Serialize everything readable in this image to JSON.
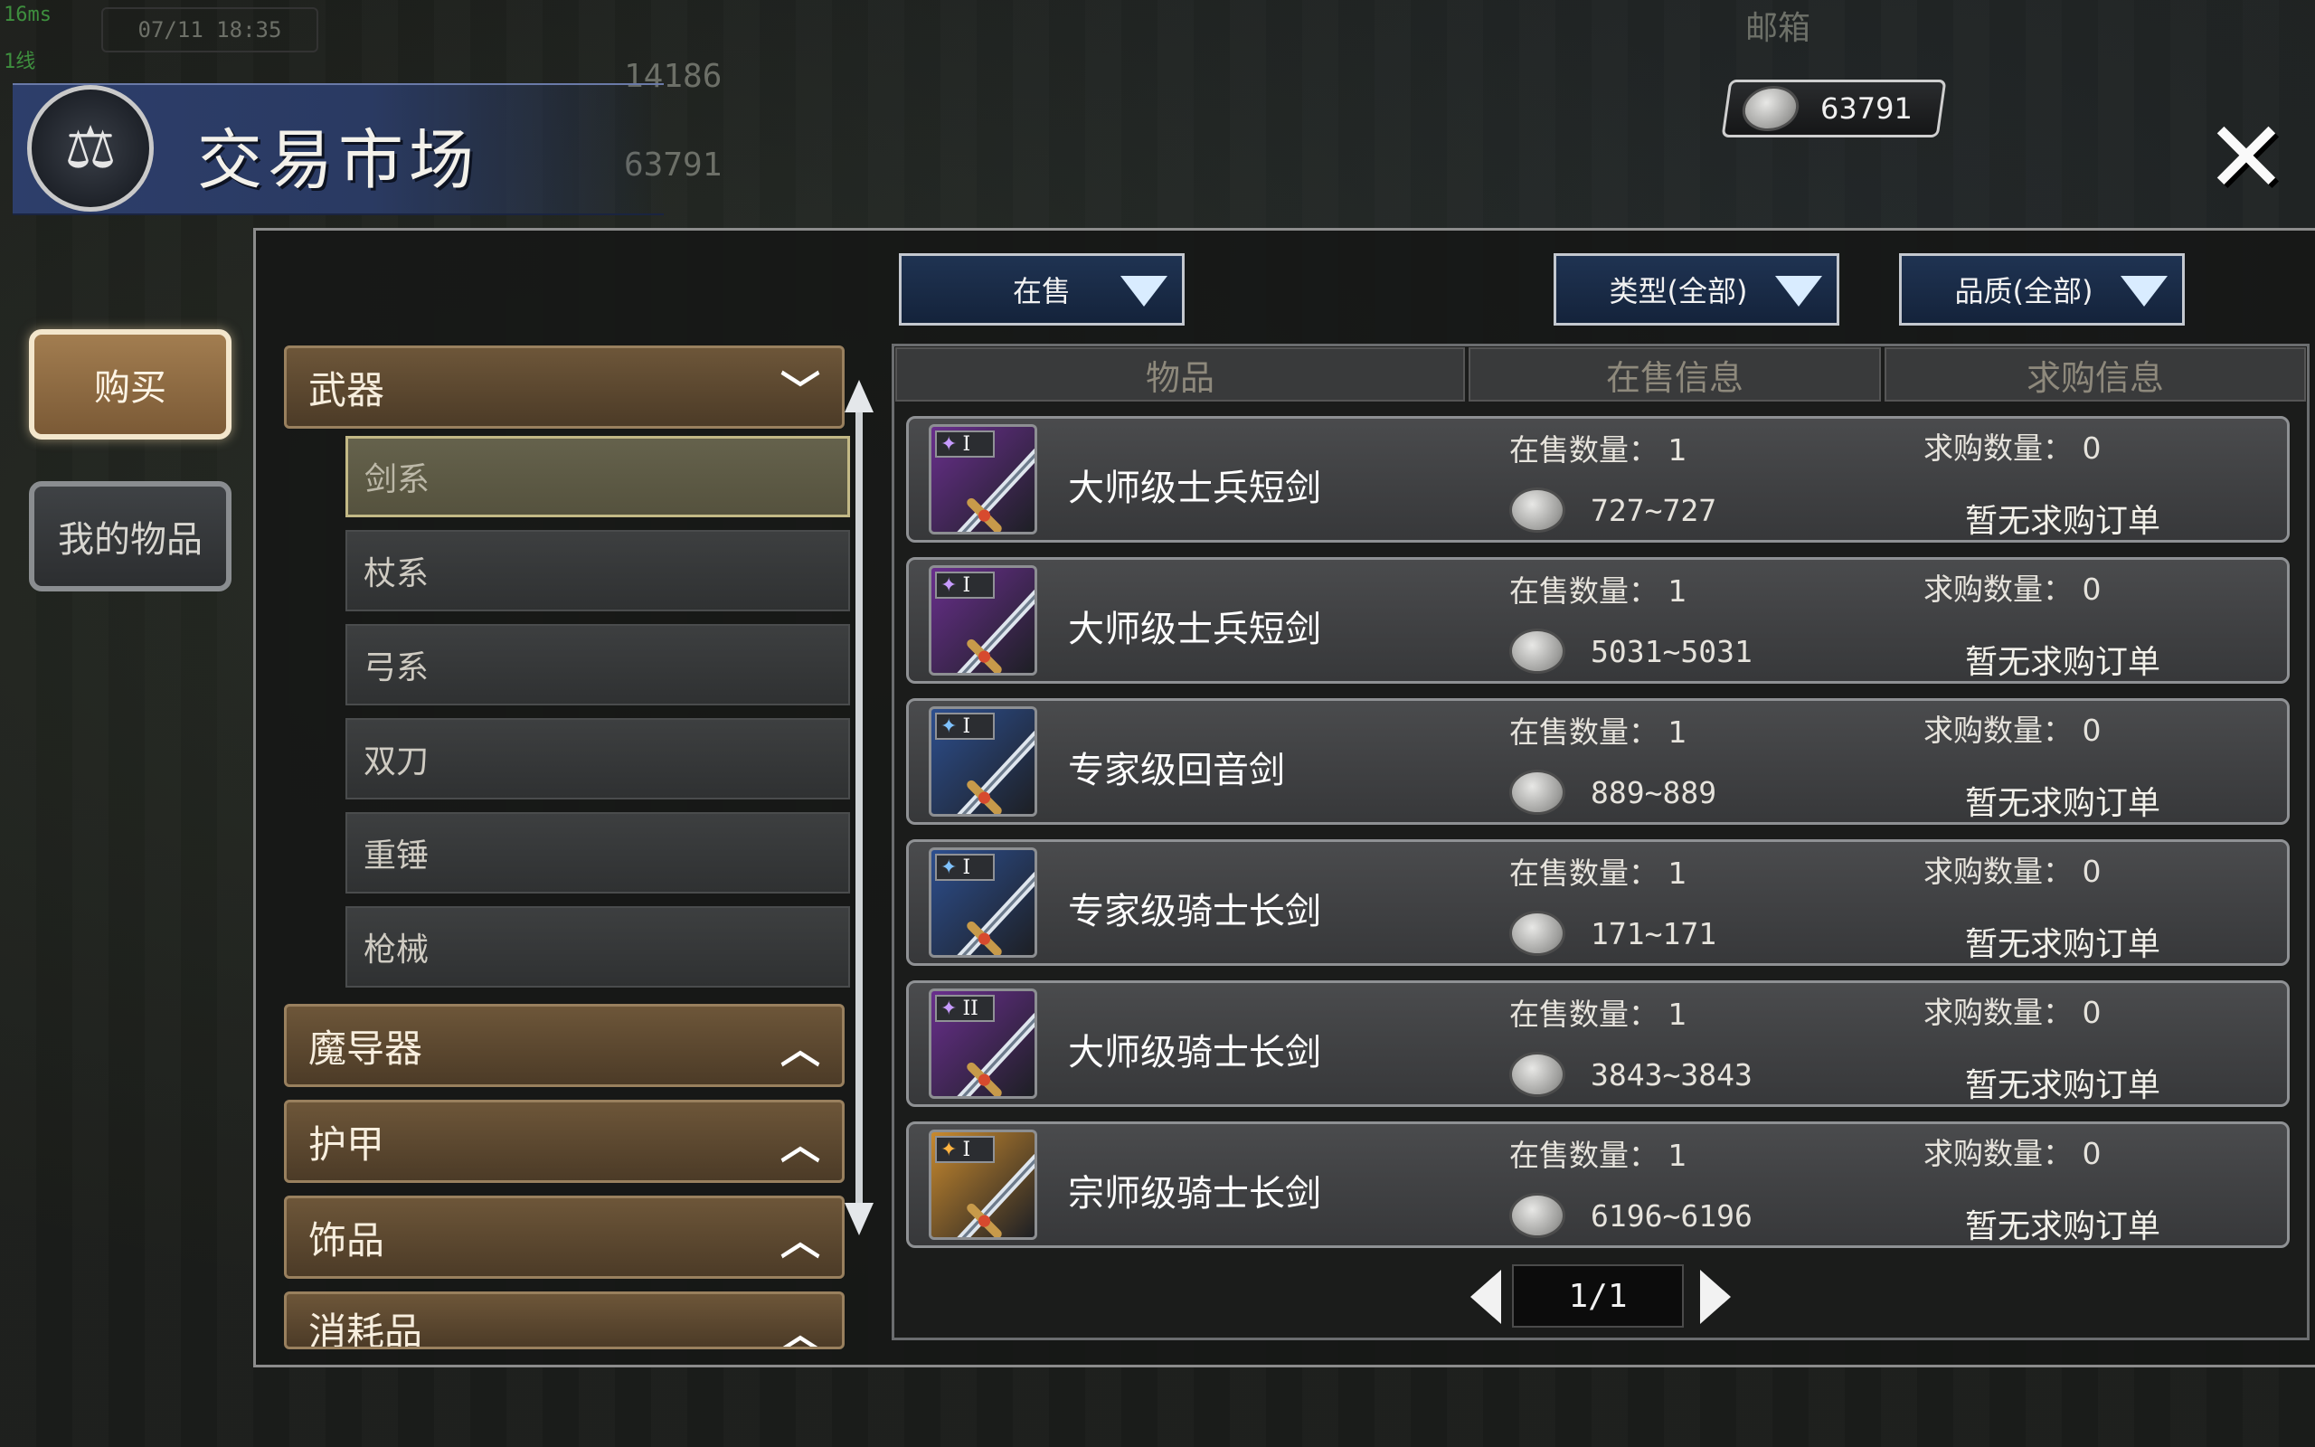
{
  "hud": {
    "ping": "16ms",
    "line": "1线",
    "datetime": "07/11 18:35",
    "mail": "邮箱",
    "bg_values": [
      "14186",
      "63791"
    ],
    "coins": "63791"
  },
  "window": {
    "title": "交易市场",
    "close_symbol": "✕"
  },
  "side_tabs": {
    "buy": "购买",
    "my_items": "我的物品"
  },
  "filters": {
    "status": "在售",
    "type": "类型(全部)",
    "quality": "品质(全部)"
  },
  "categories": {
    "weapons": "武器",
    "magic": "魔导器",
    "armor": "护甲",
    "accessories": "饰品",
    "consumables": "消耗品"
  },
  "weapon_subs": [
    "剑系",
    "杖系",
    "弓系",
    "双刀",
    "重锤",
    "枪械"
  ],
  "columns": {
    "item": "物品",
    "sale_info": "在售信息",
    "buy_info": "求购信息"
  },
  "rows": [
    {
      "name": "大师级士兵短剑",
      "tier": "I",
      "bg": "purple",
      "star": "#c79bff",
      "sale": "在售数量：  1",
      "price": "727~727",
      "buy": "求购数量：  0",
      "status": "暂无求购订单"
    },
    {
      "name": "大师级士兵短剑",
      "tier": "I",
      "bg": "purple",
      "star": "#c79bff",
      "sale": "在售数量：  1",
      "price": "5031~5031",
      "buy": "求购数量：  0",
      "status": "暂无求购订单"
    },
    {
      "name": "专家级回音剑",
      "tier": "I",
      "bg": "blue",
      "star": "#7fc2ff",
      "sale": "在售数量：  1",
      "price": "889~889",
      "buy": "求购数量：  0",
      "status": "暂无求购订单"
    },
    {
      "name": "专家级骑士长剑",
      "tier": "I",
      "bg": "blue",
      "star": "#7fc2ff",
      "sale": "在售数量：  1",
      "price": "171~171",
      "buy": "求购数量：  0",
      "status": "暂无求购订单"
    },
    {
      "name": "大师级骑士长剑",
      "tier": "II",
      "bg": "purple",
      "star": "#c79bff",
      "sale": "在售数量：  1",
      "price": "3843~3843",
      "buy": "求购数量：  0",
      "status": "暂无求购订单"
    },
    {
      "name": "宗师级骑士长剑",
      "tier": "I",
      "bg": "gold",
      "star": "#ffb340",
      "sale": "在售数量：  1",
      "price": "6196~6196",
      "buy": "求购数量：  0",
      "status": "暂无求购订单"
    }
  ],
  "pager": {
    "page": "1/1"
  },
  "colors": {
    "purple": "#6a2f8e",
    "blue": "#2d4f8f",
    "gold": "#c98a2e",
    "accent_tab": "#8f6b44"
  }
}
